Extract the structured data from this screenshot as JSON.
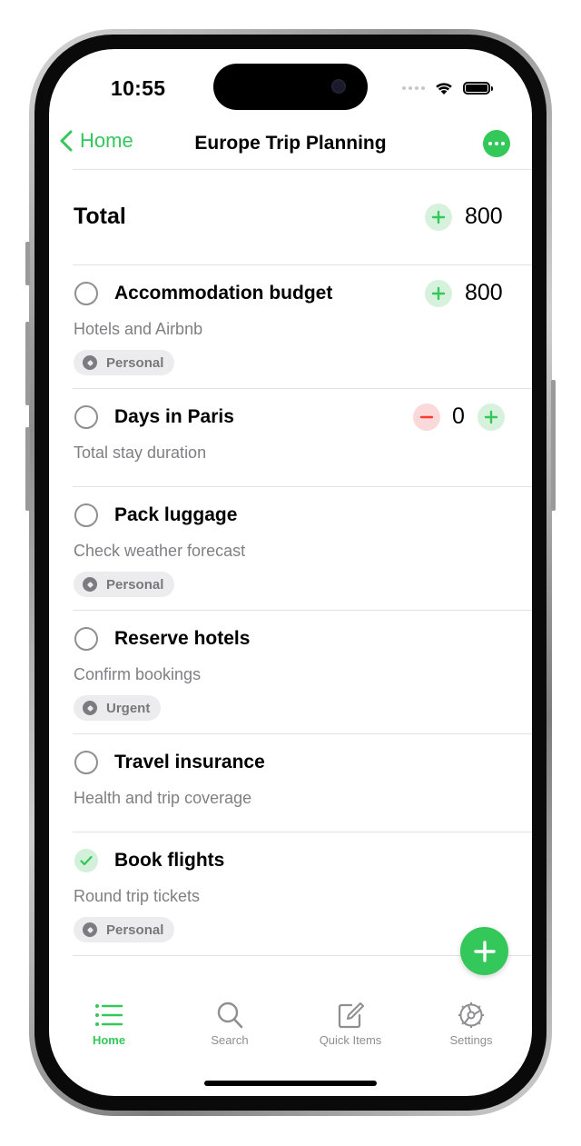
{
  "status_bar": {
    "time": "10:55"
  },
  "nav": {
    "back_label": "Home",
    "title": "Europe Trip Planning"
  },
  "total": {
    "label": "Total",
    "value": "800"
  },
  "items": [
    {
      "title": "Accommodation budget",
      "subtitle": "Hotels and Airbnb",
      "tag": "Personal",
      "counter": "800",
      "completed": false
    },
    {
      "title": "Days in Paris",
      "subtitle": "Total stay duration",
      "counter": "0",
      "completed": false
    },
    {
      "title": "Pack luggage",
      "subtitle": "Check weather forecast",
      "tag": "Personal",
      "completed": false
    },
    {
      "title": "Reserve hotels",
      "subtitle": "Confirm bookings",
      "tag": "Urgent",
      "completed": false
    },
    {
      "title": "Travel insurance",
      "subtitle": "Health and trip coverage",
      "completed": false
    },
    {
      "title": "Book flights",
      "subtitle": "Round trip tickets",
      "tag": "Personal",
      "completed": true
    }
  ],
  "tabbar": [
    {
      "label": "Home",
      "icon": "list-icon",
      "active": true
    },
    {
      "label": "Search",
      "icon": "magnifier-icon",
      "active": false
    },
    {
      "label": "Quick Items",
      "icon": "compose-icon",
      "active": false
    },
    {
      "label": "Settings",
      "icon": "gear-icon",
      "active": false
    }
  ],
  "colors": {
    "accent": "#34c759",
    "minus_bg": "#fbd9da",
    "plus_bg": "#d6f2dd",
    "minus": "#ff3b30"
  }
}
